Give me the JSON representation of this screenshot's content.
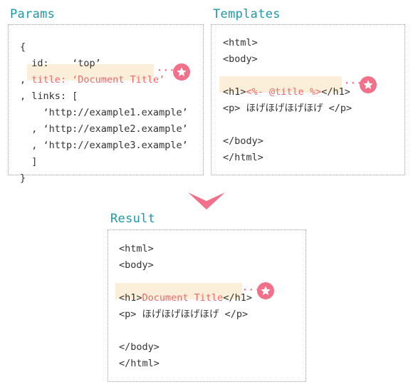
{
  "params": {
    "heading": "Params",
    "open_brace": "{",
    "id_line": "  id:    ‘top’",
    "title_comma": ",",
    "title_key": " title: ",
    "title_value": "‘Document Title’",
    "links_line": ", links: [",
    "link1": "    ‘http://example1.example’",
    "link2": "  , ‘http://example2.example’",
    "link3": "  , ‘http://example3.example’",
    "close_bracket": "  ]",
    "close_brace": "}"
  },
  "templates": {
    "heading": "Templates",
    "html_open": "<html>",
    "body_open": "<body>",
    "h1_open": "<h1>",
    "h1_expr": "<%- @title %>",
    "h1_close": "</h1>",
    "p_line": "<p> ほげほげほげほげ </p>",
    "body_close": "</body>",
    "html_close": "</html>"
  },
  "result": {
    "heading": "Result",
    "html_open": "<html>",
    "body_open": "<body>",
    "h1_open": "<h1>",
    "h1_value": "Document Title",
    "h1_close": "</h1>",
    "p_line": "<p> ほげほげほげほげ </p>",
    "body_close": "</body>",
    "html_close": "</html>"
  },
  "connector": {
    "dots": "···"
  },
  "colors": {
    "heading": "#1a9aa6",
    "accent": "#f2708a",
    "highlight": "#fcefd9",
    "value_red": "#e86a70"
  }
}
